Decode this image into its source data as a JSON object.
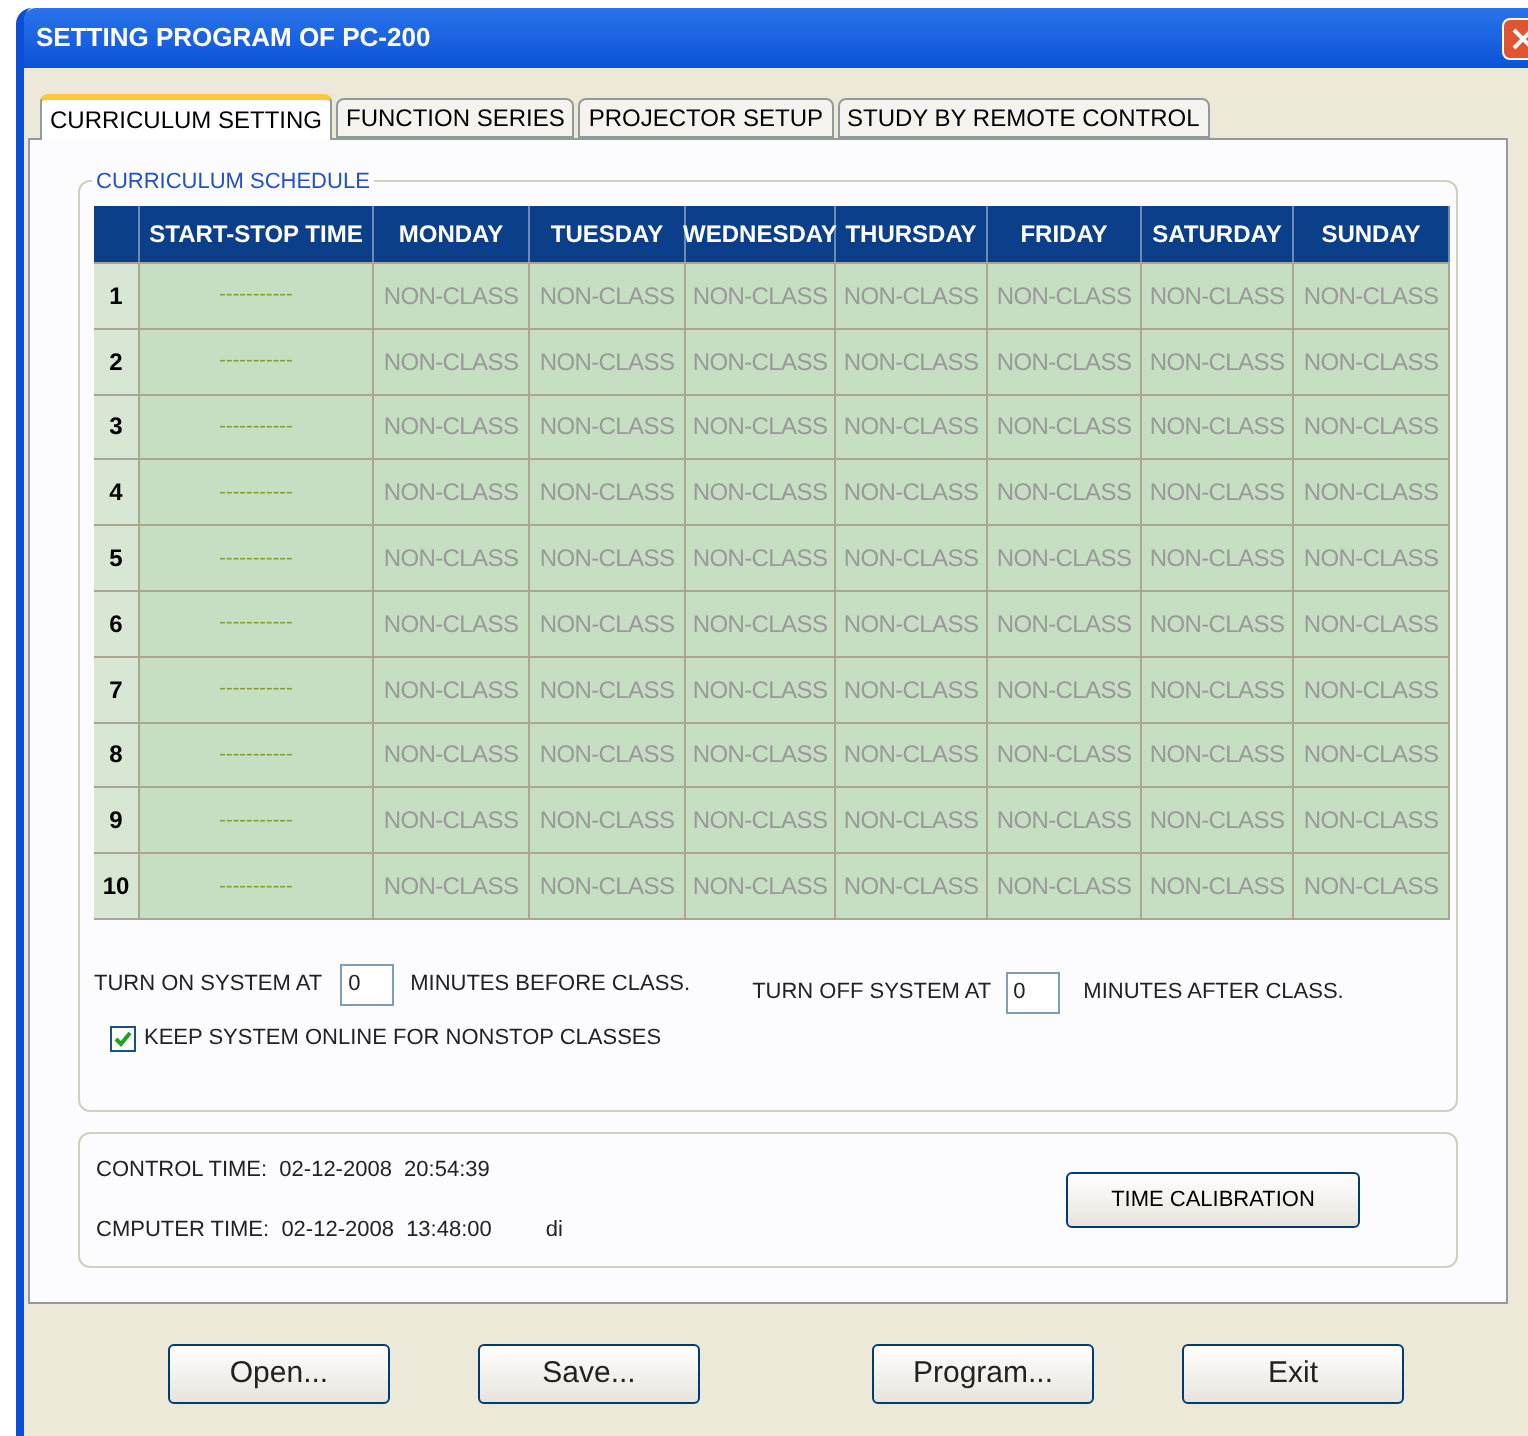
{
  "window": {
    "title": "SETTING PROGRAM OF PC-200"
  },
  "tabs": [
    {
      "label": "CURRICULUM SETTING",
      "selected": true
    },
    {
      "label": "FUNCTION SERIES",
      "selected": false
    },
    {
      "label": "PROJECTOR SETUP",
      "selected": false
    },
    {
      "label": "STUDY BY REMOTE CONTROL",
      "selected": false
    }
  ],
  "schedule": {
    "title": "CURRICULUM SCHEDULE",
    "columns": [
      "",
      "START-STOP TIME",
      "MONDAY",
      "TUESDAY",
      "WEDNESDAY",
      "THURSDAY",
      "FRIDAY",
      "SATURDAY",
      "SUNDAY"
    ],
    "rows": [
      [
        "1",
        "-----------",
        "NON-CLASS",
        "NON-CLASS",
        "NON-CLASS",
        "NON-CLASS",
        "NON-CLASS",
        "NON-CLASS",
        "NON-CLASS"
      ],
      [
        "2",
        "-----------",
        "NON-CLASS",
        "NON-CLASS",
        "NON-CLASS",
        "NON-CLASS",
        "NON-CLASS",
        "NON-CLASS",
        "NON-CLASS"
      ],
      [
        "3",
        "-----------",
        "NON-CLASS",
        "NON-CLASS",
        "NON-CLASS",
        "NON-CLASS",
        "NON-CLASS",
        "NON-CLASS",
        "NON-CLASS"
      ],
      [
        "4",
        "-----------",
        "NON-CLASS",
        "NON-CLASS",
        "NON-CLASS",
        "NON-CLASS",
        "NON-CLASS",
        "NON-CLASS",
        "NON-CLASS"
      ],
      [
        "5",
        "-----------",
        "NON-CLASS",
        "NON-CLASS",
        "NON-CLASS",
        "NON-CLASS",
        "NON-CLASS",
        "NON-CLASS",
        "NON-CLASS"
      ],
      [
        "6",
        "-----------",
        "NON-CLASS",
        "NON-CLASS",
        "NON-CLASS",
        "NON-CLASS",
        "NON-CLASS",
        "NON-CLASS",
        "NON-CLASS"
      ],
      [
        "7",
        "-----------",
        "NON-CLASS",
        "NON-CLASS",
        "NON-CLASS",
        "NON-CLASS",
        "NON-CLASS",
        "NON-CLASS",
        "NON-CLASS"
      ],
      [
        "8",
        "-----------",
        "NON-CLASS",
        "NON-CLASS",
        "NON-CLASS",
        "NON-CLASS",
        "NON-CLASS",
        "NON-CLASS",
        "NON-CLASS"
      ],
      [
        "9",
        "-----------",
        "NON-CLASS",
        "NON-CLASS",
        "NON-CLASS",
        "NON-CLASS",
        "NON-CLASS",
        "NON-CLASS",
        "NON-CLASS"
      ],
      [
        "10",
        "-----------",
        "NON-CLASS",
        "NON-CLASS",
        "NON-CLASS",
        "NON-CLASS",
        "NON-CLASS",
        "NON-CLASS",
        "NON-CLASS"
      ]
    ],
    "turn_on": {
      "label": "TURN ON SYSTEM AT",
      "value": "0",
      "suffix": "MINUTES BEFORE CLASS."
    },
    "turn_off": {
      "label": "TURN OFF SYSTEM AT",
      "value": "0",
      "suffix": "MINUTES AFTER CLASS."
    },
    "keep_online": {
      "label": "KEEP SYSTEM ONLINE FOR NONSTOP CLASSES",
      "checked": true
    }
  },
  "time": {
    "control": "CONTROL TIME:  02-12-2008  20:54:39",
    "computer": "CMPUTER TIME:  02-12-2008  13:48:00",
    "computer_note": "di",
    "button": "TIME CALIBRATION"
  },
  "buttons": [
    "Open...",
    "Save...",
    "Program...",
    "Exit"
  ]
}
